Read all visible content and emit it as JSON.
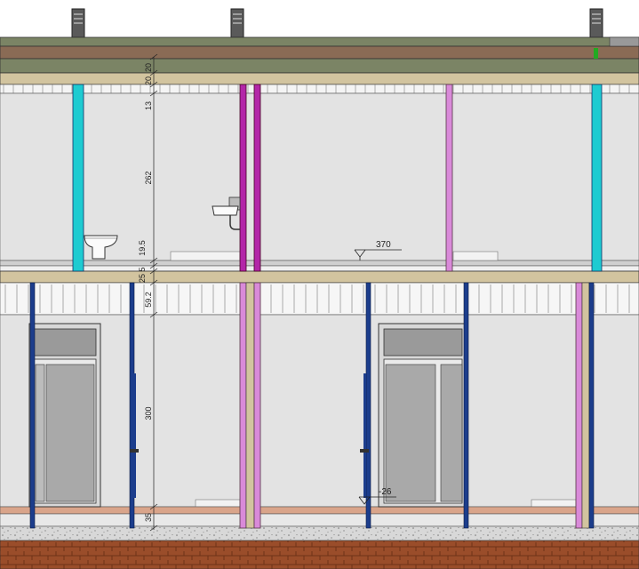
{
  "drawing": {
    "type": "architectural section elevation",
    "colors": {
      "wall": "#e3e3e3",
      "beam": "#d2c49f",
      "roof_top": "#7b8465",
      "roof_mid": "#8a6b55",
      "roof_upper": "#b5a583",
      "cyan_column": "#1ecbd1",
      "magenta_column": "#b326a8",
      "pink_column": "#d98ad9",
      "blue_column": "#1c3d8c",
      "floor_slab": "#cfcfcf",
      "ground": "#9a4d2a",
      "chimney": "#555555",
      "marker": "#22aa22"
    },
    "dimensions": {
      "top_chain": [
        "20",
        "20",
        "13",
        "262",
        "19.5"
      ],
      "middle_chain": [
        "5",
        "25",
        "59.2"
      ],
      "bottom_chain": [
        "300",
        "35"
      ]
    },
    "annotations": {
      "upper_level": "370",
      "lower_level": "-26"
    },
    "fixtures": [
      "toilet-icon",
      "sink-icon"
    ]
  }
}
